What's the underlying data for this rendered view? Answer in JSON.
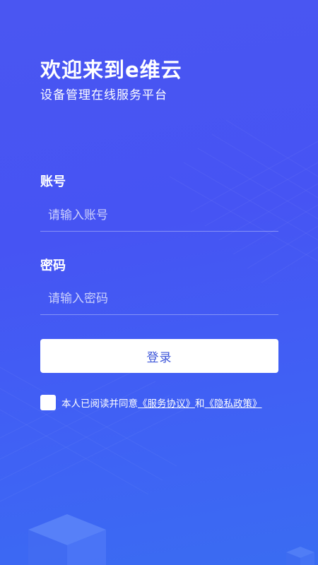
{
  "header": {
    "title": "欢迎来到e维云",
    "subtitle": "设备管理在线服务平台"
  },
  "account": {
    "label": "账号",
    "placeholder": "请输入账号",
    "value": ""
  },
  "password": {
    "label": "密码",
    "placeholder": "请输入密码",
    "value": ""
  },
  "login": {
    "label": "登录"
  },
  "agreement": {
    "checked": false,
    "prefix": "本人已阅读并同意",
    "service_link": "《服务协议》",
    "conjunction": "和",
    "privacy_link": "《隐私政策》"
  },
  "colors": {
    "background_top": "#4a56f2",
    "background_bottom": "#3a6cf2",
    "button_text": "#3d56d9",
    "text": "#ffffff"
  }
}
